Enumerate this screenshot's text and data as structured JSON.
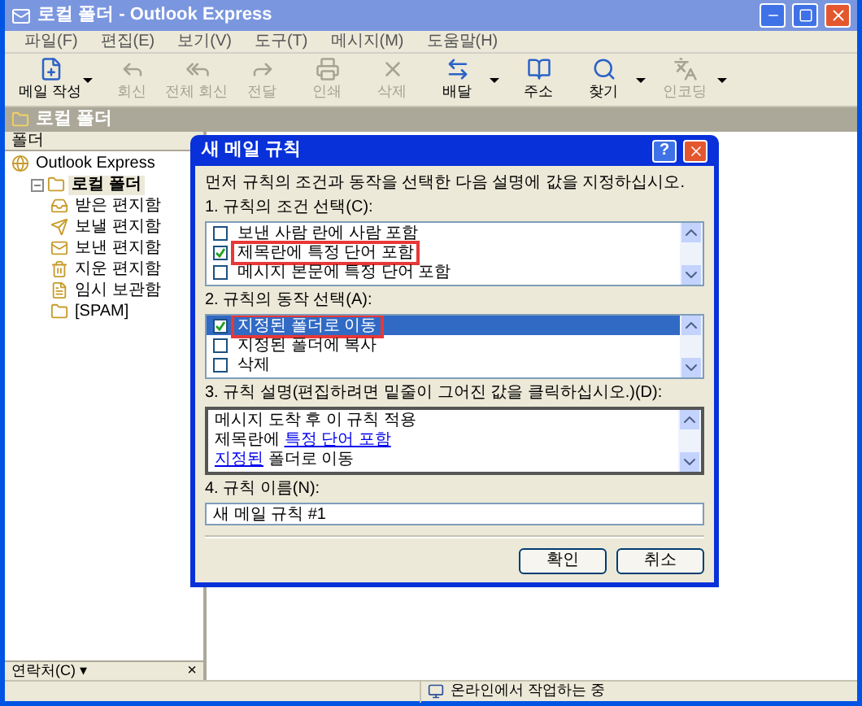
{
  "window": {
    "title": "로컬 폴더 - Outlook Express"
  },
  "menu": [
    "파일(F)",
    "편집(E)",
    "보기(V)",
    "도구(T)",
    "메시지(M)",
    "도움말(H)"
  ],
  "toolbar": [
    {
      "label": "메일 작성",
      "disabled": false,
      "dropdown": true
    },
    {
      "label": "회신",
      "disabled": true,
      "dropdown": false
    },
    {
      "label": "전체 회신",
      "disabled": true,
      "dropdown": false
    },
    {
      "label": "전달",
      "disabled": true,
      "dropdown": false
    },
    {
      "label": "인쇄",
      "disabled": true,
      "dropdown": false
    },
    {
      "label": "삭제",
      "disabled": true,
      "dropdown": false
    },
    {
      "label": "배달",
      "disabled": false,
      "dropdown": true
    },
    {
      "label": "주소",
      "disabled": false,
      "dropdown": false
    },
    {
      "label": "찾기",
      "disabled": false,
      "dropdown": true
    },
    {
      "label": "인코딩",
      "disabled": true,
      "dropdown": true
    }
  ],
  "folder_bar": {
    "title": "로컬 폴더"
  },
  "folders": {
    "header": "폴더",
    "tree": [
      {
        "label": "Outlook Express",
        "selected": false,
        "children": [
          {
            "label": "로컬 폴더",
            "selected": true,
            "expanded": true,
            "children": [
              {
                "label": "받은 편지함",
                "selected": false
              },
              {
                "label": "보낼 편지함",
                "selected": false
              },
              {
                "label": "보낸 편지함",
                "selected": false
              },
              {
                "label": "지운 편지함",
                "selected": false
              },
              {
                "label": "임시 보관함",
                "selected": false
              },
              {
                "label": "[SPAM]",
                "selected": false
              }
            ]
          }
        ]
      }
    ]
  },
  "contacts": {
    "label": "연락처(C) ▾",
    "close": "×"
  },
  "status_bar": {
    "text": "온라인에서 작업하는 중"
  },
  "dialog": {
    "title": "새 메일 규칙",
    "help": "?",
    "intro": "먼저 규칙의 조건과 동작을 선택한 다음 설명에 값을 지정하십시오.",
    "conditions_label": "1. 규칙의 조건 선택(C):",
    "conditions": [
      {
        "label": "보낸 사람 란에 사람 포함",
        "checked": false,
        "selected": false,
        "highlighted": false
      },
      {
        "label": "제목란에 특정 단어 포함",
        "checked": true,
        "selected": false,
        "highlighted": true
      },
      {
        "label": "메시지 본문에 특정 단어 포함",
        "checked": false,
        "selected": false,
        "highlighted": false
      }
    ],
    "actions_label": "2. 규칙의 동작 선택(A):",
    "actions": [
      {
        "label": "지정된 폴더로 이동",
        "checked": true,
        "selected": true,
        "highlighted": true
      },
      {
        "label": "지정된 폴더에 복사",
        "checked": false,
        "selected": false,
        "highlighted": false
      },
      {
        "label": "삭제",
        "checked": false,
        "selected": false,
        "highlighted": false
      }
    ],
    "description_label": "3. 규칙 설명(편집하려면 밑줄이 그어진 값을 클릭하십시오.)(D):",
    "description": [
      [
        {
          "text": "메시지 도착 후 이 규칙 적용",
          "link": false
        }
      ],
      [
        {
          "text": "제목란에 ",
          "link": false
        },
        {
          "text": "특정 단어 포함",
          "link": true
        }
      ],
      [
        {
          "text": "지정된",
          "link": true
        },
        {
          "text": " 폴더로 이동",
          "link": false
        }
      ]
    ],
    "name_label": "4. 규칙 이름(N):",
    "name_value": "새 메일 규칙 #1",
    "buttons": [
      "확인",
      "취소"
    ]
  }
}
